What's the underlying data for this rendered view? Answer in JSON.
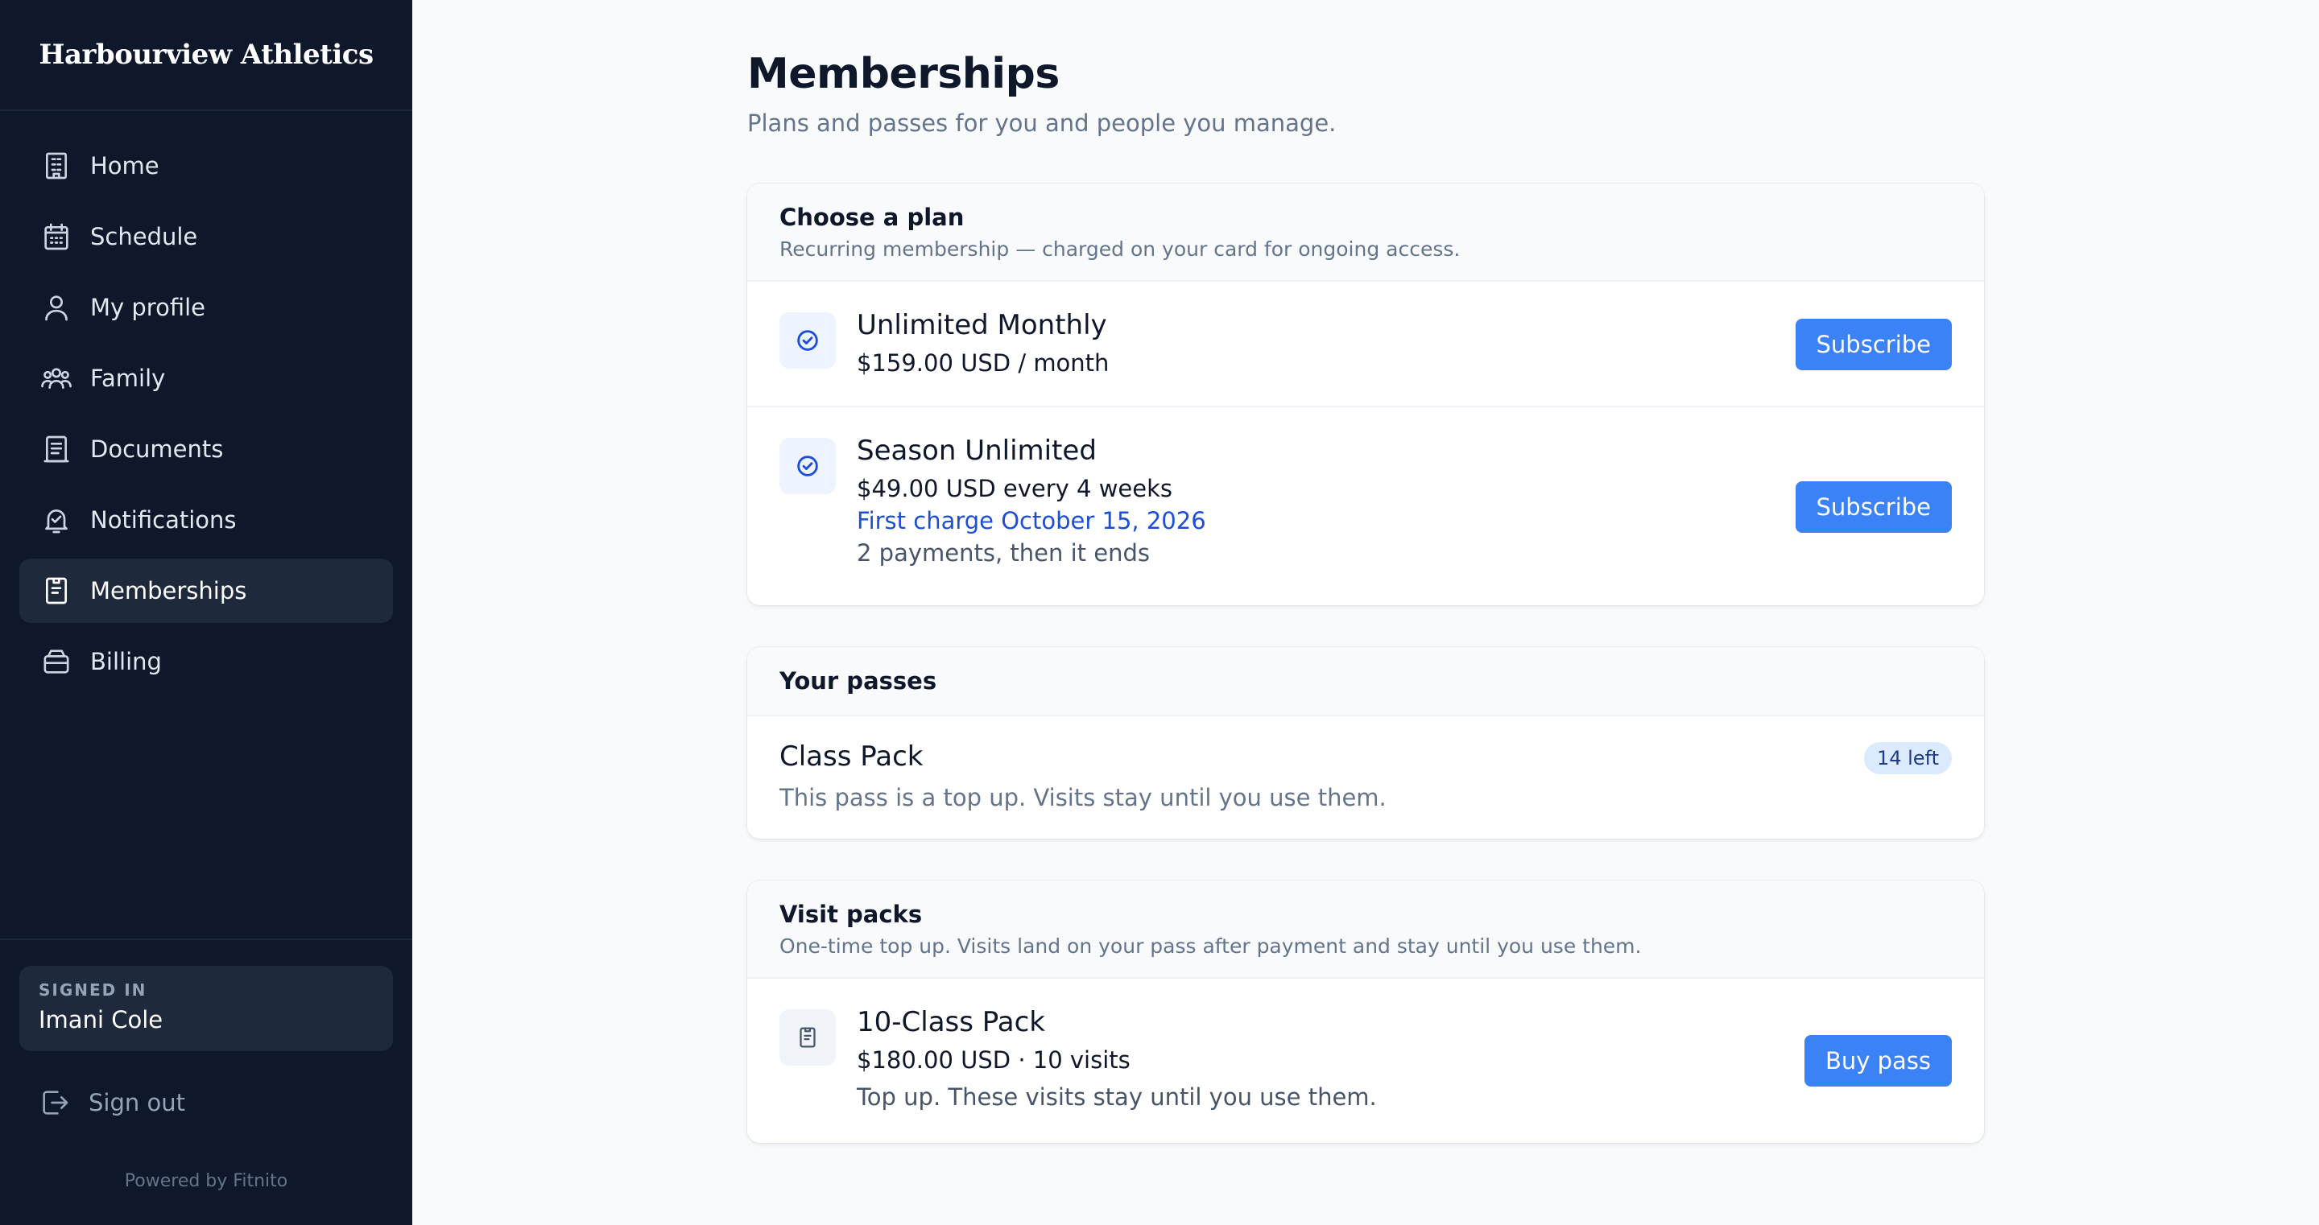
{
  "brand": {
    "name": "Harbourview Athletics"
  },
  "nav": {
    "items": [
      {
        "label": "Home",
        "icon": "building-icon"
      },
      {
        "label": "Schedule",
        "icon": "calendar-icon"
      },
      {
        "label": "My profile",
        "icon": "user-icon"
      },
      {
        "label": "Family",
        "icon": "users-icon"
      },
      {
        "label": "Documents",
        "icon": "document-icon"
      },
      {
        "label": "Notifications",
        "icon": "bell-icon"
      },
      {
        "label": "Memberships",
        "icon": "clipboard-icon",
        "active": true
      },
      {
        "label": "Billing",
        "icon": "wallet-icon"
      }
    ]
  },
  "account": {
    "caption": "SIGNED IN",
    "name": "Imani Cole",
    "signout_label": "Sign out"
  },
  "footer": {
    "powered_by": "Powered by Fitnito"
  },
  "page": {
    "title": "Memberships",
    "subtitle": "Plans and passes for you and people you manage."
  },
  "plans": {
    "heading": "Choose a plan",
    "subheading": "Recurring membership — charged on your card for ongoing access.",
    "items": [
      {
        "name": "Unlimited Monthly",
        "price": "$159.00 USD / month",
        "button": "Subscribe"
      },
      {
        "name": "Season Unlimited",
        "price": "$49.00 USD every 4 weeks",
        "first_charge": "First charge October 15, 2026",
        "note": "2 payments, then it ends",
        "button": "Subscribe"
      }
    ]
  },
  "passes": {
    "heading": "Your passes",
    "items": [
      {
        "name": "Class Pack",
        "badge": "14 left",
        "note": "This pass is a top up. Visits stay until you use them."
      }
    ]
  },
  "visit_packs": {
    "heading": "Visit packs",
    "subheading": "One-time top up. Visits land on your pass after payment and stay until you use them.",
    "items": [
      {
        "name": "10-Class Pack",
        "price": "$180.00 USD · 10 visits",
        "note": "Top up. These visits stay until you use them.",
        "button": "Buy pass"
      }
    ]
  },
  "colors": {
    "sidebar_bg": "#0f172a",
    "accent": "#3b82f6",
    "link": "#1d4ed8",
    "page_bg": "#f8fafc"
  }
}
